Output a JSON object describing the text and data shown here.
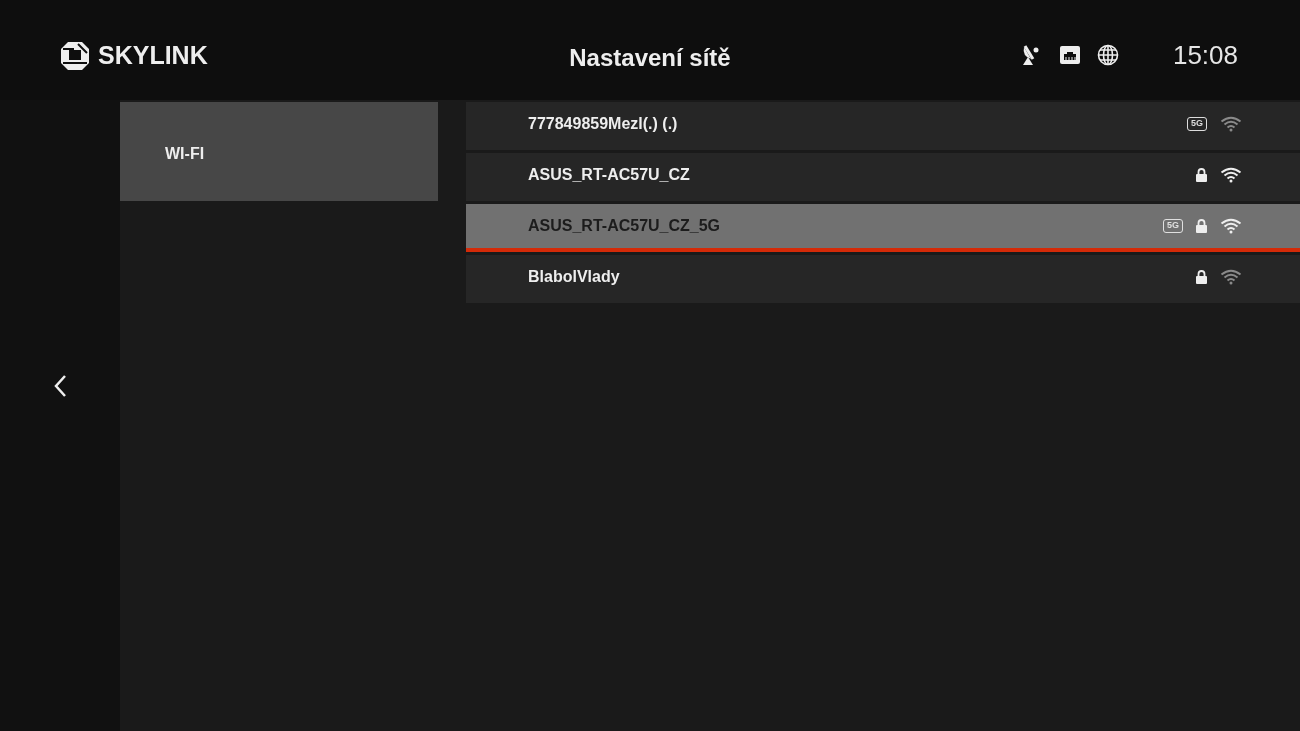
{
  "header": {
    "logo": "SKYLINK",
    "title": "Nastavení sítě",
    "time": "15:08"
  },
  "sidebar": {
    "items": [
      {
        "label": "WI-FI",
        "selected": true
      }
    ]
  },
  "networks": [
    {
      "name": "777849859Mezl(.) (.)",
      "band": "5G",
      "secured": false,
      "strong_signal": false,
      "selected": false
    },
    {
      "name": "ASUS_RT-AC57U_CZ",
      "secured": true,
      "strong_signal": true,
      "selected": false
    },
    {
      "name": "ASUS_RT-AC57U_CZ_5G",
      "band": "5G",
      "secured": true,
      "strong_signal": true,
      "selected": true
    },
    {
      "name": "BlabolVlady",
      "secured": true,
      "strong_signal": false,
      "selected": false
    }
  ]
}
